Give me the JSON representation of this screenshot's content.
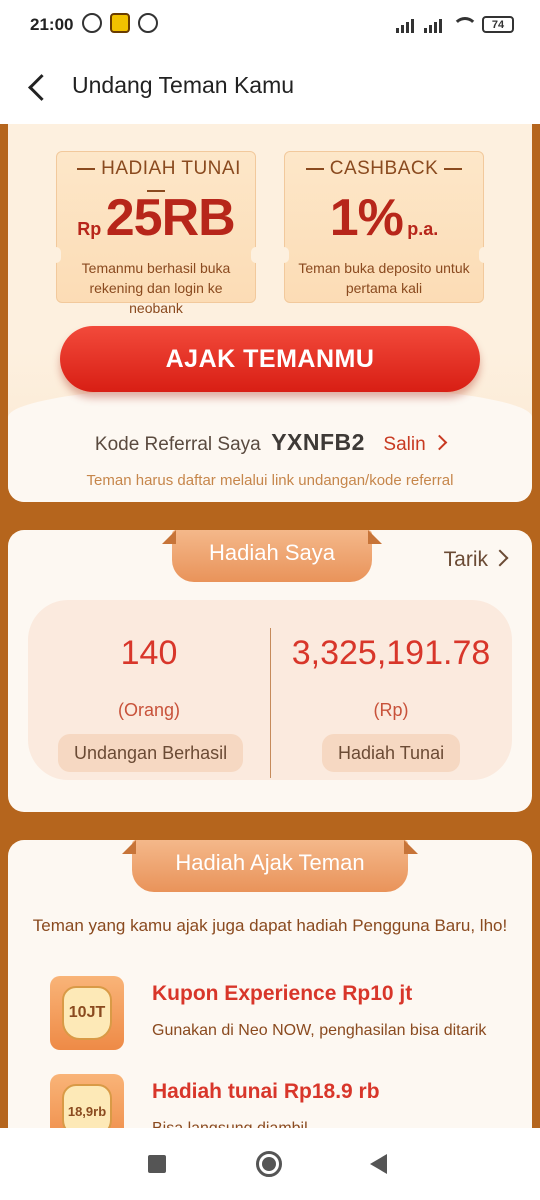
{
  "status_bar": {
    "time": "21:00",
    "battery": "74"
  },
  "header": {
    "title": "Undang Teman Kamu"
  },
  "rewards": [
    {
      "title": "HADIAH TUNAI",
      "prefix": "Rp",
      "value": "25RB",
      "suffix": "",
      "desc": "Temanmu berhasil buka rekening dan login ke neobank"
    },
    {
      "title": "CASHBACK",
      "prefix": "",
      "value": "1%",
      "suffix": "p.a.",
      "desc": "Teman buka deposito untuk pertama kali"
    }
  ],
  "cta": {
    "label": "AJAK TEMANMU"
  },
  "referral": {
    "label": "Kode Referral Saya",
    "code": "YXNFB2",
    "copy_label": "Salin",
    "note": "Teman harus daftar melalui link undangan/kode referral"
  },
  "my_rewards": {
    "title": "Hadiah Saya",
    "withdraw_label": "Tarik",
    "invited": {
      "value": "140",
      "unit": "(Orang)",
      "label": "Undangan Berhasil"
    },
    "cash": {
      "value": "3,325,191.78",
      "unit": "(Rp)",
      "label": "Hadiah Tunai"
    }
  },
  "invite_rewards": {
    "title": "Hadiah Ajak Teman",
    "desc": "Teman yang kamu ajak juga dapat hadiah Pengguna Baru, lho!",
    "items": [
      {
        "icon_text": "10JT",
        "title": "Kupon Experience Rp10 jt",
        "desc": "Gunakan di Neo NOW, penghasilan bisa ditarik"
      },
      {
        "icon_text": "18,9rb",
        "title": "Hadiah tunai Rp18.9 rb",
        "desc": "Bisa langsung diambil"
      }
    ]
  },
  "colors": {
    "accent": "#d81e14",
    "brown_bg": "#b5651d",
    "card_bg": "#fdf8f2"
  }
}
